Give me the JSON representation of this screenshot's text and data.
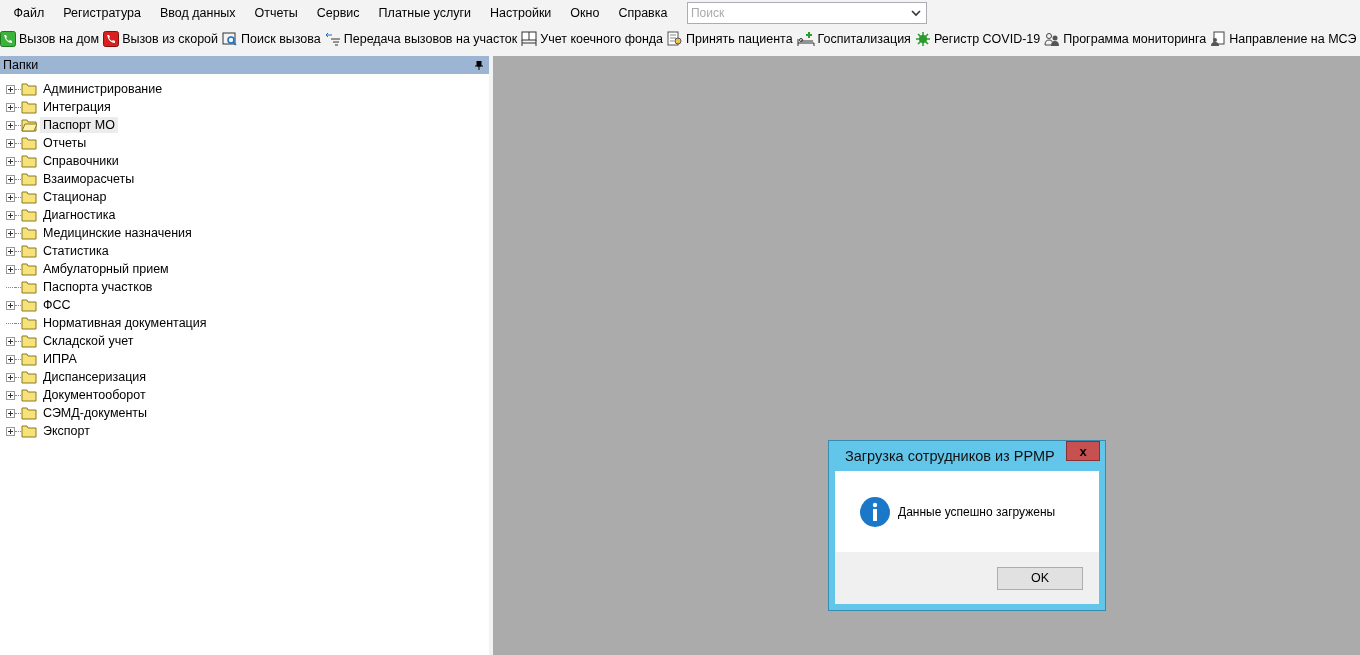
{
  "menu": [
    "Файл",
    "Регистратура",
    "Ввод данных",
    "Отчеты",
    "Сервис",
    "Платные услуги",
    "Настройки",
    "Окно",
    "Справка"
  ],
  "search": {
    "placeholder": "Поиск"
  },
  "toolbar": [
    {
      "label": "Вызов на дом",
      "kind": "call-home"
    },
    {
      "label": "Вызов из скорой",
      "kind": "call-ambulance"
    },
    {
      "label": "Поиск вызова",
      "kind": "find"
    },
    {
      "label": "Передача вызовов на участок",
      "kind": "transfer"
    },
    {
      "label": "Учет коечного фонда",
      "kind": "beds"
    },
    {
      "label": "Принять пациента",
      "kind": "accept"
    },
    {
      "label": "Госпитализация",
      "kind": "hospital"
    },
    {
      "label": "Регистр COVID-19",
      "kind": "virus"
    },
    {
      "label": "Программа мониторинга",
      "kind": "people"
    },
    {
      "label": "Направление на МСЭ",
      "kind": "referral"
    }
  ],
  "panel": {
    "title": "Папки"
  },
  "tree": [
    {
      "label": "Администрирование",
      "expandable": true,
      "selected": false
    },
    {
      "label": "Интеграция",
      "expandable": true,
      "selected": false
    },
    {
      "label": "Паспорт МО",
      "expandable": true,
      "selected": true
    },
    {
      "label": "Отчеты",
      "expandable": true,
      "selected": false
    },
    {
      "label": "Справочники",
      "expandable": true,
      "selected": false
    },
    {
      "label": "Взаиморасчеты",
      "expandable": true,
      "selected": false
    },
    {
      "label": "Стационар",
      "expandable": true,
      "selected": false
    },
    {
      "label": "Диагностика",
      "expandable": true,
      "selected": false
    },
    {
      "label": "Медицинские назначения",
      "expandable": true,
      "selected": false
    },
    {
      "label": "Статистика",
      "expandable": true,
      "selected": false
    },
    {
      "label": "Амбулаторный прием",
      "expandable": true,
      "selected": false
    },
    {
      "label": "Паспорта участков",
      "expandable": false,
      "selected": false
    },
    {
      "label": "ФСС",
      "expandable": true,
      "selected": false
    },
    {
      "label": "Нормативная документация",
      "expandable": false,
      "selected": false
    },
    {
      "label": "Складской учет",
      "expandable": true,
      "selected": false
    },
    {
      "label": "ИПРА",
      "expandable": true,
      "selected": false
    },
    {
      "label": "Диспансеризация",
      "expandable": true,
      "selected": false
    },
    {
      "label": "Документооборот",
      "expandable": true,
      "selected": false
    },
    {
      "label": "СЭМД-документы",
      "expandable": true,
      "selected": false
    },
    {
      "label": "Экспорт",
      "expandable": true,
      "selected": false
    }
  ],
  "dialog": {
    "title": "Загрузка сотрудников из РРМР",
    "close": "x",
    "message": "Данные успешно загружены",
    "button": "OK"
  }
}
